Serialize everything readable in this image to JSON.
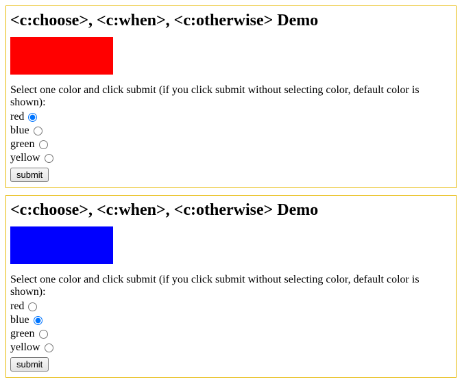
{
  "panels": [
    {
      "title": "<c:choose>, <c:when>, <c:otherwise> Demo",
      "swatch_color": "#ff0000",
      "instruction": "Select one color and click submit (if you click submit without selecting color, default color is shown):",
      "options": [
        {
          "label": "red",
          "checked": true
        },
        {
          "label": "blue",
          "checked": false
        },
        {
          "label": "green",
          "checked": false
        },
        {
          "label": "yellow",
          "checked": false
        }
      ],
      "submit_label": "submit"
    },
    {
      "title": "<c:choose>, <c:when>, <c:otherwise> Demo",
      "swatch_color": "#0000ff",
      "instruction": "Select one color and click submit (if you click submit without selecting color, default color is shown):",
      "options": [
        {
          "label": "red",
          "checked": false
        },
        {
          "label": "blue",
          "checked": true
        },
        {
          "label": "green",
          "checked": false
        },
        {
          "label": "yellow",
          "checked": false
        }
      ],
      "submit_label": "submit"
    }
  ]
}
